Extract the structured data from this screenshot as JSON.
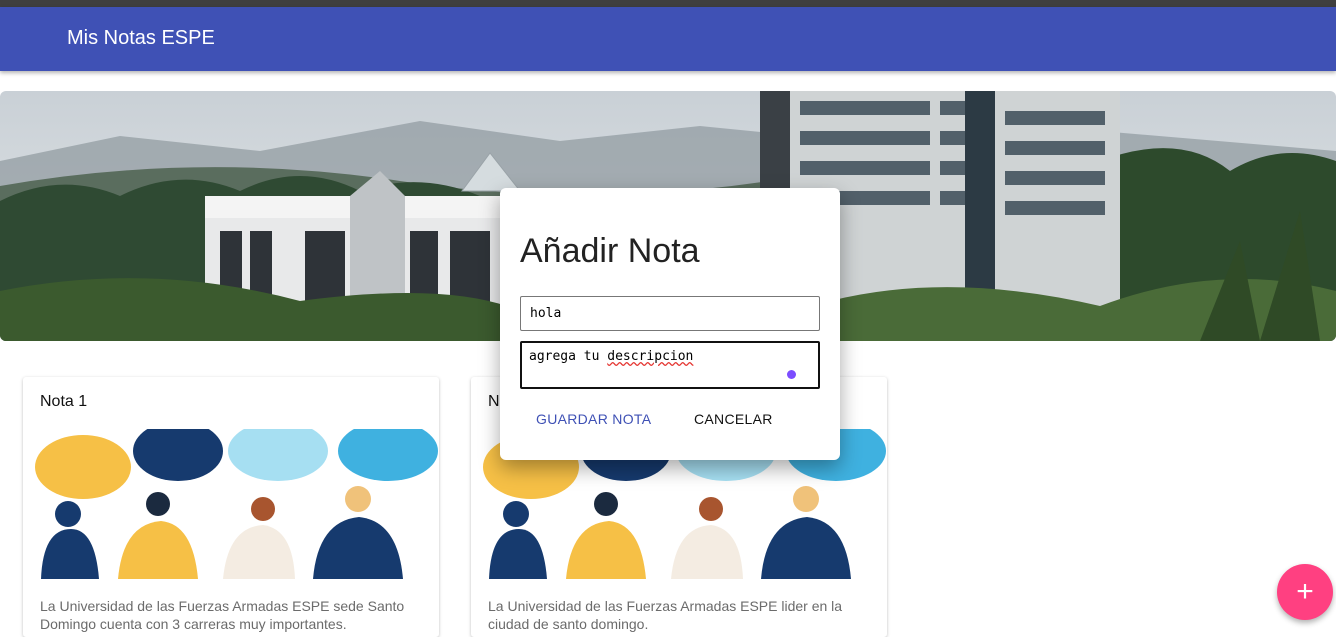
{
  "appbar": {
    "title": "Mis Notas ESPE"
  },
  "hero": {
    "description": "campus photo"
  },
  "notes": [
    {
      "title": "Nota 1",
      "description": "La Universidad de las Fuerzas Armadas ESPE sede Santo Domingo cuenta con 3 carreras muy importantes."
    },
    {
      "title": "Nota 2",
      "description": "La Universidad de las Fuerzas Armadas ESPE lider en la ciudad de santo domingo."
    }
  ],
  "dialog": {
    "title": "Añadir Nota",
    "title_input_value": "hola",
    "description_prefix": "agrega tu ",
    "description_misspelled": "descripcion",
    "save_label": "GUARDAR NOTA",
    "cancel_label": "CANCELAR"
  },
  "fab": {
    "icon": "plus-icon",
    "label": "+"
  },
  "colors": {
    "primary": "#3f51b5",
    "accent": "#ff4081",
    "topbar": "#3f3f3f"
  }
}
